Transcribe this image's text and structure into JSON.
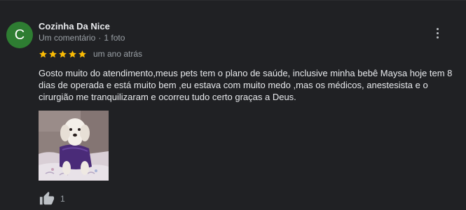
{
  "review": {
    "author": "Cozinha Da Nice",
    "avatar_letter": "C",
    "avatar_color": "#2e7d32",
    "comment_count": "Um comentário",
    "photo_count": "1 foto",
    "separator": "·",
    "rating": 5,
    "rating_max": 5,
    "star_color": "#fbbc04",
    "time": "um ano atrás",
    "text": "Gosto muito do atendimento,meus pets tem o plano de saúde, inclusive minha bebê Maysa hoje tem 8 dias de operada e está muito bem ,eu estava com muito medo ,mas os médicos, anestesista e o cirurgião me tranquilizaram e ocorreu tudo certo graças a Deus.",
    "like_count": "1",
    "menu_icon": "more-vert-icon",
    "like_icon": "thumb-up-icon"
  }
}
